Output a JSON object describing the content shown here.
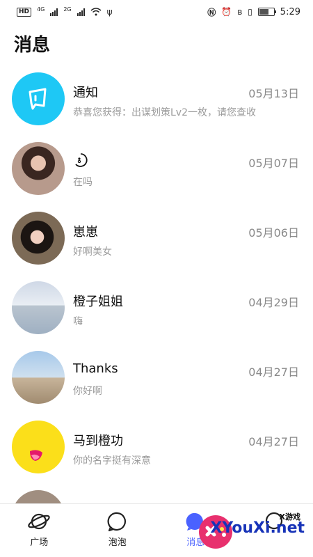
{
  "status_bar": {
    "time": "5:29",
    "badge": "HD",
    "net1": "4G",
    "net2": "2G"
  },
  "page": {
    "title": "消息"
  },
  "messages": [
    {
      "name": "通知",
      "preview": "恭喜您获得：出谋划策Lv2一枚，请您查收",
      "date": "05月13日",
      "avatar": "notification-megaphone-icon"
    },
    {
      "name": "",
      "preview": "在吗",
      "date": "05月07日",
      "avatar": "photo"
    },
    {
      "name": "崽崽",
      "preview": "好啊美女",
      "date": "05月06日",
      "avatar": "photo"
    },
    {
      "name": "橙子姐姐",
      "preview": "嗨",
      "date": "04月29日",
      "avatar": "photo"
    },
    {
      "name": "Thanks",
      "preview": "你好啊",
      "date": "04月27日",
      "avatar": "photo"
    },
    {
      "name": "马到橙功",
      "preview": "你的名字挺有深意",
      "date": "04月27日",
      "avatar": "yellow-face"
    }
  ],
  "nav": [
    {
      "label": "广场",
      "icon": "planet-icon"
    },
    {
      "label": "泡泡",
      "icon": "bubble-icon"
    },
    {
      "label": "消息",
      "icon": "message-icon",
      "active": true
    },
    {
      "label": "",
      "icon": "profile-icon"
    }
  ],
  "watermark": {
    "small": "X游戏",
    "big": "XYouXi.net"
  },
  "colors": {
    "accent": "#4a62ff",
    "notice": "#1ec8f5",
    "yellow": "#fbdf1a"
  }
}
